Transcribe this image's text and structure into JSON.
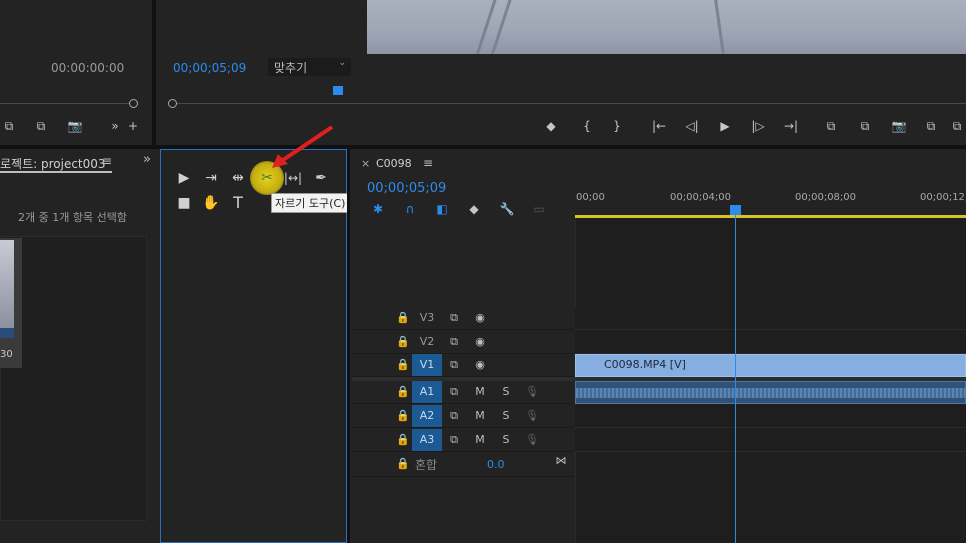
{
  "source_monitor": {
    "timecode": "00:00:00:00"
  },
  "program_monitor": {
    "timecode": "00;00;05;09",
    "fit": "맞추기"
  },
  "program_controls": [
    "◆",
    "{",
    "}",
    "|←",
    "◁|",
    "▶",
    "|▷",
    "→|",
    "⧉",
    "⧉",
    "📷",
    "⧉",
    "⧉"
  ],
  "source_controls": [
    "⧉",
    "⧉",
    "📷",
    "»",
    "+"
  ],
  "project": {
    "tab": "로젝트: project003",
    "menu": "≡",
    "more": "»",
    "selection": "2개 중 1개 항목 선택함",
    "thumb_label": "30"
  },
  "tools": {
    "row1": [
      "▶",
      "⇥",
      "⇹",
      "✂",
      "|↔|",
      "✒"
    ],
    "row2": [
      "■",
      "✋",
      "T"
    ],
    "tooltip": "자르기 도구(C)"
  },
  "timeline": {
    "close": "×",
    "tab": "C0098",
    "menu": "≡",
    "timecode": "00;00;05;09",
    "ruler": [
      "00;00",
      "00;00;04;00",
      "00;00;08;00",
      "00;00;12;"
    ],
    "tracks_video": [
      {
        "name": "V3",
        "on": false
      },
      {
        "name": "V2",
        "on": false
      },
      {
        "name": "V1",
        "on": true
      }
    ],
    "tracks_audio": [
      {
        "name": "A1",
        "on": true
      },
      {
        "name": "A2",
        "on": true
      },
      {
        "name": "A3",
        "on": true
      }
    ],
    "audio_m": "M",
    "audio_s": "S",
    "mix_label": "혼합",
    "mix_value": "0.0",
    "clip_name": "C0098.MP4 [V]"
  }
}
